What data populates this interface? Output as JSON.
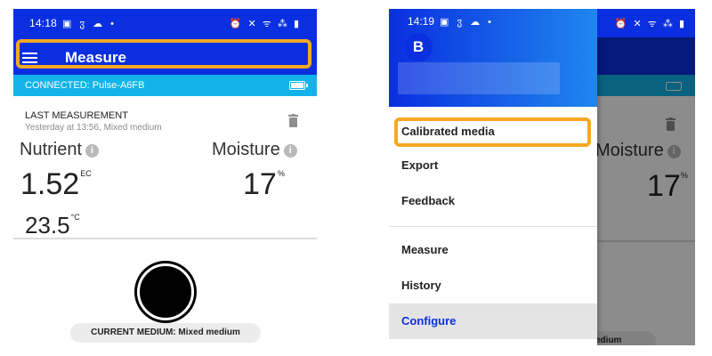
{
  "left": {
    "status_time": "14:18",
    "status_icons": "▣ ჳ ☁ •",
    "status_right": "⏰ ✕ ᯤ ⁂ ▮",
    "app_title": "Measure",
    "connected": "CONNECTED: Pulse-A6FB",
    "last_measurement_title": "LAST MEASUREMENT",
    "last_measurement_sub": "Yesterday at 13:56, Mixed medium",
    "nutrient_label": "Nutrient",
    "moisture_label": "Moisture",
    "nutrient_value": "1.52",
    "nutrient_unit": "EC",
    "moisture_value": "17",
    "moisture_unit": "%",
    "temp_value": "23.5",
    "temp_unit": "°C",
    "current_medium": "CURRENT MEDIUM: Mixed medium"
  },
  "right": {
    "status_time": "14:19",
    "status_icons": "▣ ჳ ☁ •",
    "status_right": "⏰ ✕ ᯤ ⁂ ▮",
    "logo_letter": "B",
    "bg_moisture": "Moisture",
    "bg_moisture_value": "17",
    "bg_moisture_unit": "%",
    "bg_medium_partial": "edium",
    "menu": {
      "calibrated_media": "Calibrated media",
      "export": "Export",
      "feedback": "Feedback",
      "measure": "Measure",
      "history": "History",
      "configure": "Configure"
    }
  },
  "colors": {
    "primary": "#0a2fe0",
    "connected_bar": "#12b3e8",
    "highlight": "#f6a823",
    "active_item": "#0a2fe0"
  }
}
